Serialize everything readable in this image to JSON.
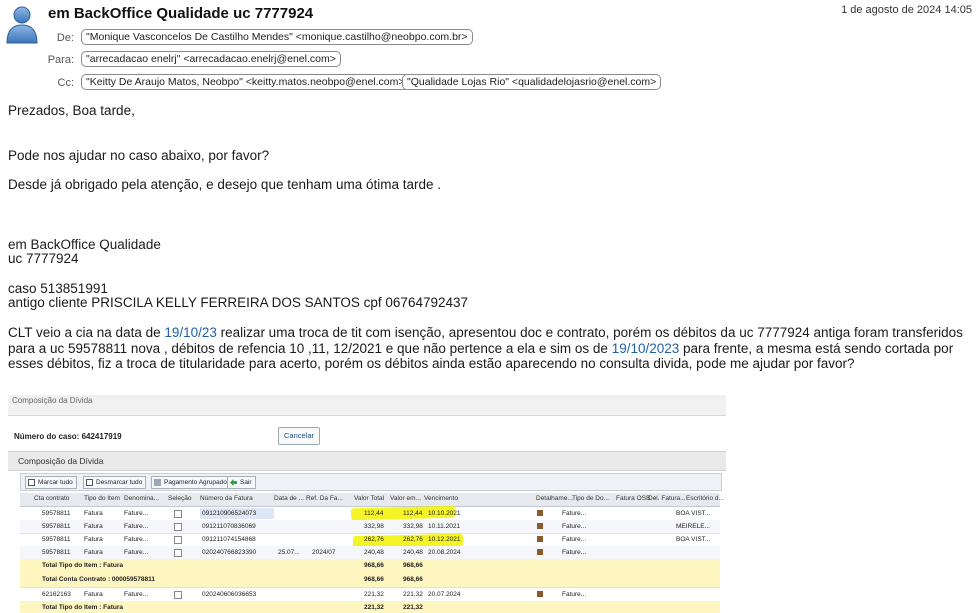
{
  "email": {
    "subject": "em BackOffice Qualidade uc 7777924",
    "date": "1 de agosto de 2024 14:05",
    "labels": {
      "from": "De:",
      "to": "Para:",
      "cc": "Cc:"
    },
    "from": "\"Monique Vasconcelos De Castilho Mendes\" <monique.castilho@neobpo.com.br>",
    "to": "\"arrecadacao enelrj\" <arrecadacao.enelrj@enel.com>",
    "cc": [
      "\"Keitty De Araujo Matos, Neobpo\" <keitty.matos.neobpo@enel.com>",
      "\"Qualidade Lojas Rio\" <qualidadelojasrio@enel.com>"
    ]
  },
  "body": {
    "greeting": "Prezados, Boa tarde,",
    "request": "Pode nos ajudar no caso abaixo, por favor?",
    "thanks": "Desde já obrigado pela atenção, e desejo que tenham uma ótima tarde .",
    "sig1": "em BackOffice Qualidade",
    "sig2": "uc 7777924",
    "caso": "caso 513851991",
    "antigo": "antigo cliente PRISCILA KELLY FERREIRA DOS SANTOS cpf 06764792437",
    "p1": "CLT veio a cia na data de ",
    "d1": "19/10/23",
    "p2": " realizar uma troca de tit com isenção, apresentou doc e contrato, porém os débitos da uc 7777924 antiga foram transferidos",
    "p3": "para a uc 59578811 nova , débitos de refencia 10 ,11, 12/2021 e que não pertence a ela e sim os de ",
    "d2": "19/10/2023",
    "p4": " para frente, a mesma está sendo cortada por",
    "p5": "esses débitos, fiz a troca de titularidade para acerto, porém os débitos ainda estão aparecendo no consulta divida, pode me ajudar por favor?"
  },
  "screenshot": {
    "band_title": "Composição da Dívida",
    "caso_label": "Número do caso: 642417919",
    "cancel": "Cancelar",
    "section": "Composição da Dívida",
    "toolbar": [
      "Marcar tudo",
      "Desmarcar tudo",
      "Pagamento Agrupado",
      "Sair"
    ],
    "columns": [
      "Cta contrato",
      "Tipo do Item",
      "Denomina...",
      "Seleção",
      "Número da Fatura",
      "Data de ...",
      "Ref. Da Fa...",
      "Valor Total",
      "Valor em...",
      "Vencimento",
      "Detalhame...",
      "Tipo de Do...",
      "Fatura OSB",
      "Del. Fatura...",
      "Escritório d..."
    ],
    "rows": [
      {
        "cta": "59578811",
        "tipo": "Fatura",
        "den": "Fature...",
        "num": "091210906524073",
        "data": "",
        "ref": "",
        "total": "112,44",
        "em": "112,44",
        "venc": "10.10.2021",
        "tdoc": "Fature...",
        "esc": "BOA VIST..."
      },
      {
        "cta": "59578811",
        "tipo": "Fatura",
        "den": "Fature...",
        "num": "091211070836069",
        "data": "",
        "ref": "",
        "total": "332,98",
        "em": "332,98",
        "venc": "10.11.2021",
        "tdoc": "Fature...",
        "esc": "MEIRELE..."
      },
      {
        "cta": "59578811",
        "tipo": "Fatura",
        "den": "Fature...",
        "num": "091211074154868",
        "data": "",
        "ref": "",
        "total": "262,76",
        "em": "262,76",
        "venc": "10.12.2021",
        "tdoc": "Fature...",
        "esc": "BOA VIST..."
      },
      {
        "cta": "59578811",
        "tipo": "Fatura",
        "den": "Fature...",
        "num": "020240766823390",
        "data": "25.07...",
        "ref": "2024/07",
        "total": "240,48",
        "em": "240,48",
        "venc": "20.08.2024",
        "tdoc": "Fature...",
        "esc": ""
      }
    ],
    "totals": [
      {
        "label": "Total Tipo do Item : Fatura",
        "total": "968,66",
        "em": "968,66"
      },
      {
        "label": "Total Conta Contrato : 000059578811",
        "total": "968,66",
        "em": "968,66"
      }
    ],
    "row5": {
      "cta": "62162163",
      "tipo": "Fatura",
      "den": "Fature...",
      "num": "020240606036653",
      "total": "221,32",
      "em": "221,32",
      "venc": "20.07.2024",
      "tdoc": "Fature..."
    },
    "total_last": {
      "label": "Total Tipo do Item : Fatura",
      "total": "221,32",
      "em": "221,32"
    }
  }
}
